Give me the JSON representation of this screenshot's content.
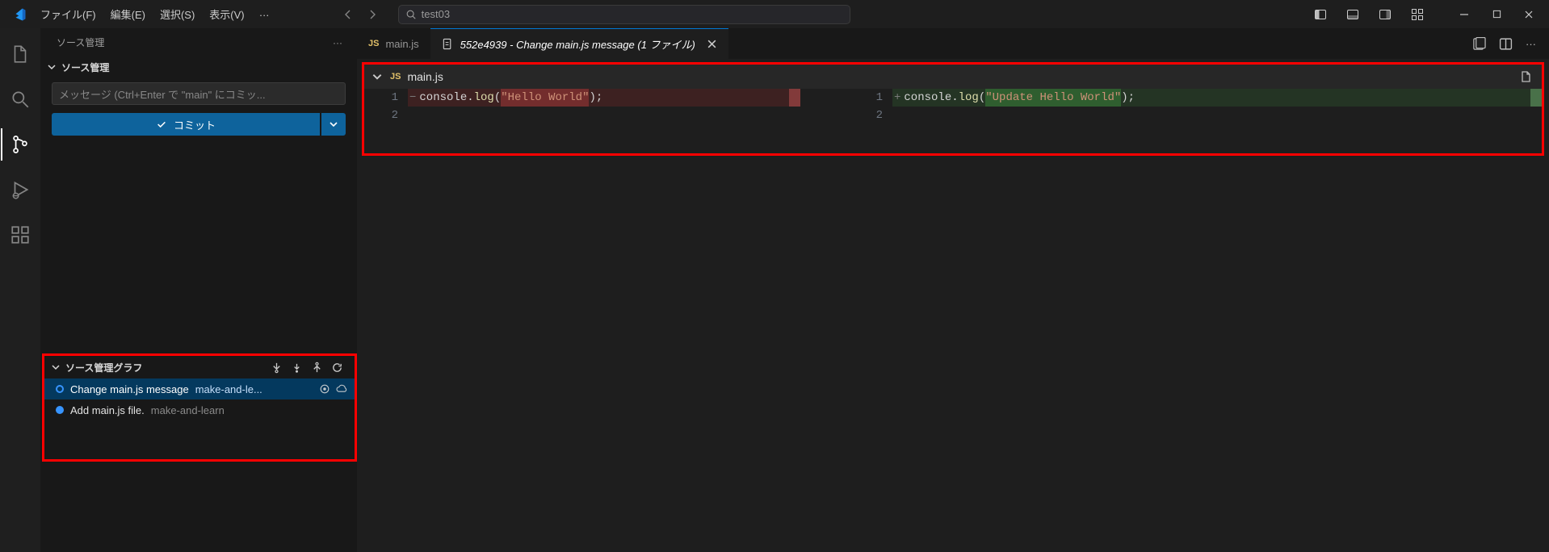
{
  "menu": {
    "file": "ファイル(F)",
    "edit": "編集(E)",
    "select": "選択(S)",
    "view": "表示(V)",
    "more": "…"
  },
  "search": {
    "project": "test03"
  },
  "panel": {
    "title": "ソース管理",
    "section": "ソース管理",
    "message_placeholder": "メッセージ (Ctrl+Enter で \"main\" にコミッ...",
    "commit_label": "コミット"
  },
  "graph": {
    "title": "ソース管理グラフ",
    "items": [
      {
        "title": "Change main.js message",
        "author": "make-and-le..."
      },
      {
        "title": "Add main.js file.",
        "author": "make-and-learn"
      }
    ]
  },
  "tabs": {
    "inactive": {
      "filename": "main.js"
    },
    "active": {
      "hash": "552e4939",
      "separator": " - ",
      "title": "Change main.js message",
      "suffix": " (1 ファイル)"
    }
  },
  "diff": {
    "filename": "main.js",
    "left": {
      "lines": [
        "1",
        "2"
      ],
      "code_prefix": "console.",
      "code_fn": "log",
      "code_open": "(",
      "code_str": "\"Hello World\"",
      "code_close": ");"
    },
    "right": {
      "lines": [
        "1",
        "2"
      ],
      "code_prefix": "console.",
      "code_fn": "log",
      "code_open": "(",
      "code_str": "\"Update Hello World\"",
      "code_close": ");"
    }
  }
}
